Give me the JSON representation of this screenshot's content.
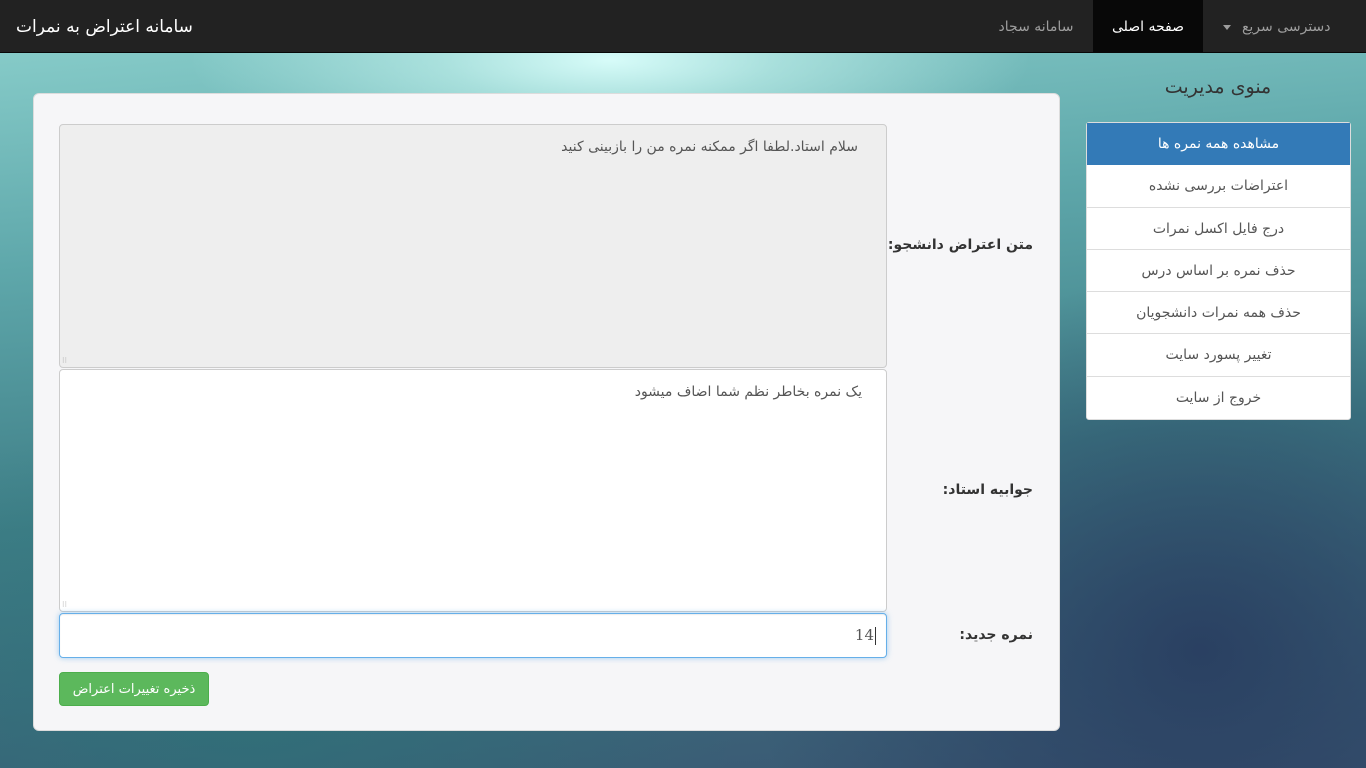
{
  "navbar": {
    "brand": "سامانه اعتراض به نمرات",
    "items": [
      {
        "label": "دسترسی سریع",
        "has_dropdown": true
      },
      {
        "label": "صفحه اصلی",
        "active": true
      },
      {
        "label": "سامانه سجاد"
      }
    ]
  },
  "sidebar": {
    "title": "منوی مدیریت",
    "items": [
      {
        "label": "مشاهده همه نمره ها",
        "active": true
      },
      {
        "label": "اعتراضات بررسی نشده"
      },
      {
        "label": "درج فایل اکسل نمرات"
      },
      {
        "label": "حذف نمره بر اساس درس"
      },
      {
        "label": "حذف همه نمرات دانشجویان"
      },
      {
        "label": "تغییر پسورد سایت"
      },
      {
        "label": "خروج از سایت"
      }
    ]
  },
  "form": {
    "complaint_label": "متن اعتراض دانشجو:",
    "complaint_text": "سلام استاد.لطفا اگر ممکنه نمره من را بازبینی کنید",
    "reply_label": "جوابیه استاد:",
    "reply_text": "یک نمره بخاطر نظم شما اضاف میشود",
    "grade_label": "نمره جدید:",
    "grade_value": "14",
    "save_label": "ذخیره تغییرات اعتراض"
  },
  "colors": {
    "navbar_bg": "#222222",
    "active_menu": "#337ab7",
    "save_button": "#5cb85c"
  }
}
